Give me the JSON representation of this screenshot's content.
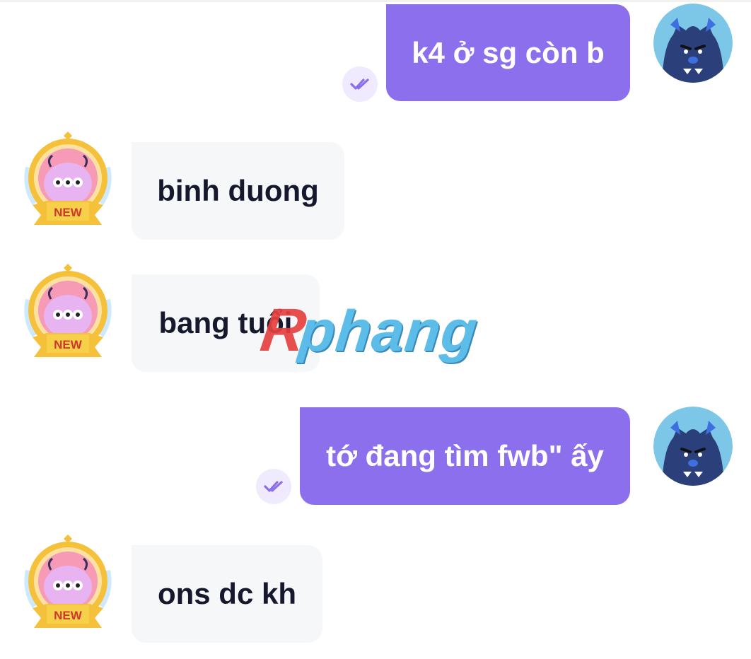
{
  "messages": [
    {
      "sender": "me",
      "text": "k4 ở sg còn b",
      "status": "read-check-icon"
    },
    {
      "sender": "them",
      "text": "binh duong"
    },
    {
      "sender": "them",
      "text": "bang tuổi"
    },
    {
      "sender": "me",
      "text": "tớ đang tìm fwb\" ấy",
      "status": "read-check-icon"
    },
    {
      "sender": "them",
      "text": "ons dc kh"
    }
  ],
  "badge_text": "NEW",
  "watermark": {
    "initial": "R",
    "rest": "phang"
  },
  "colors": {
    "my_bubble": "#8b6fed",
    "their_bubble": "#f6f7f9",
    "their_text": "#16192e",
    "check_bg": "#efeafd",
    "check_stroke": "#8b6fed"
  }
}
